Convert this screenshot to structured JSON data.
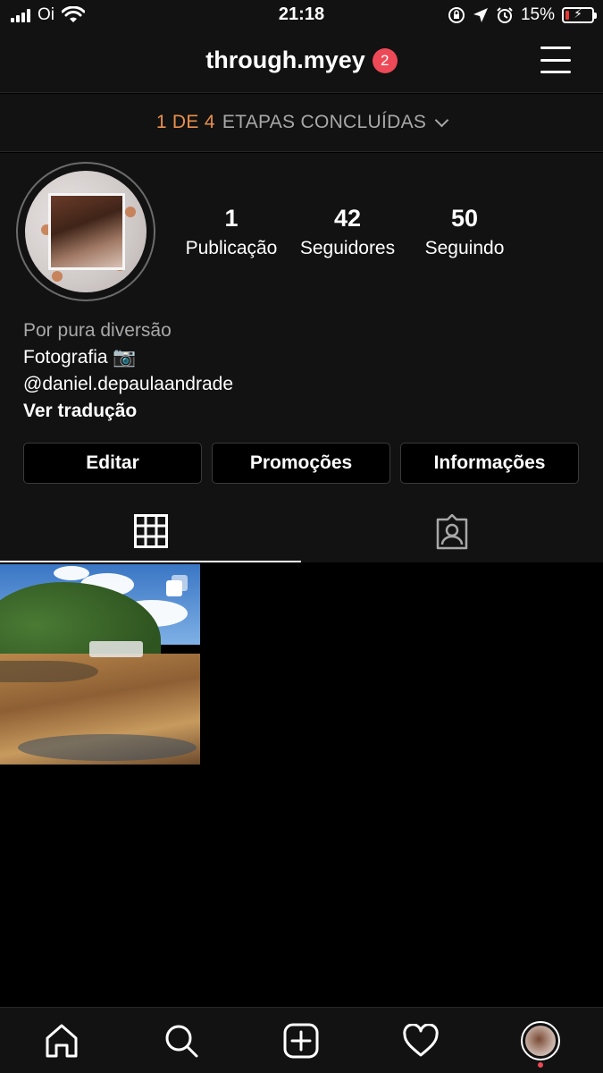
{
  "status_bar": {
    "carrier": "Oi",
    "time": "21:18",
    "battery_percent": "15%",
    "battery_level": 0.15,
    "icons": [
      "signal-icon",
      "wifi-icon",
      "rotation-lock-icon",
      "location-icon",
      "alarm-icon",
      "battery-icon"
    ]
  },
  "header": {
    "username": "through.myey",
    "notification_count": "2"
  },
  "steps": {
    "count": "1 DE 4",
    "label": "ETAPAS CONCLUÍDAS"
  },
  "profile": {
    "stats": [
      {
        "value": "1",
        "label": "Publicação"
      },
      {
        "value": "42",
        "label": "Seguidores"
      },
      {
        "value": "50",
        "label": "Seguindo"
      }
    ],
    "bio": {
      "category": "Por pura diversão",
      "line1": "Fotografia 📷",
      "mention": "@daniel.depaulaandrade",
      "translate": "Ver tradução"
    },
    "buttons": {
      "edit": "Editar",
      "promotions": "Promoções",
      "insights": "Informações"
    }
  },
  "colors": {
    "background": "#121212",
    "accent_orange": "#e8904c",
    "badge_red": "#ed4956",
    "muted_text": "#a8a8a8"
  }
}
